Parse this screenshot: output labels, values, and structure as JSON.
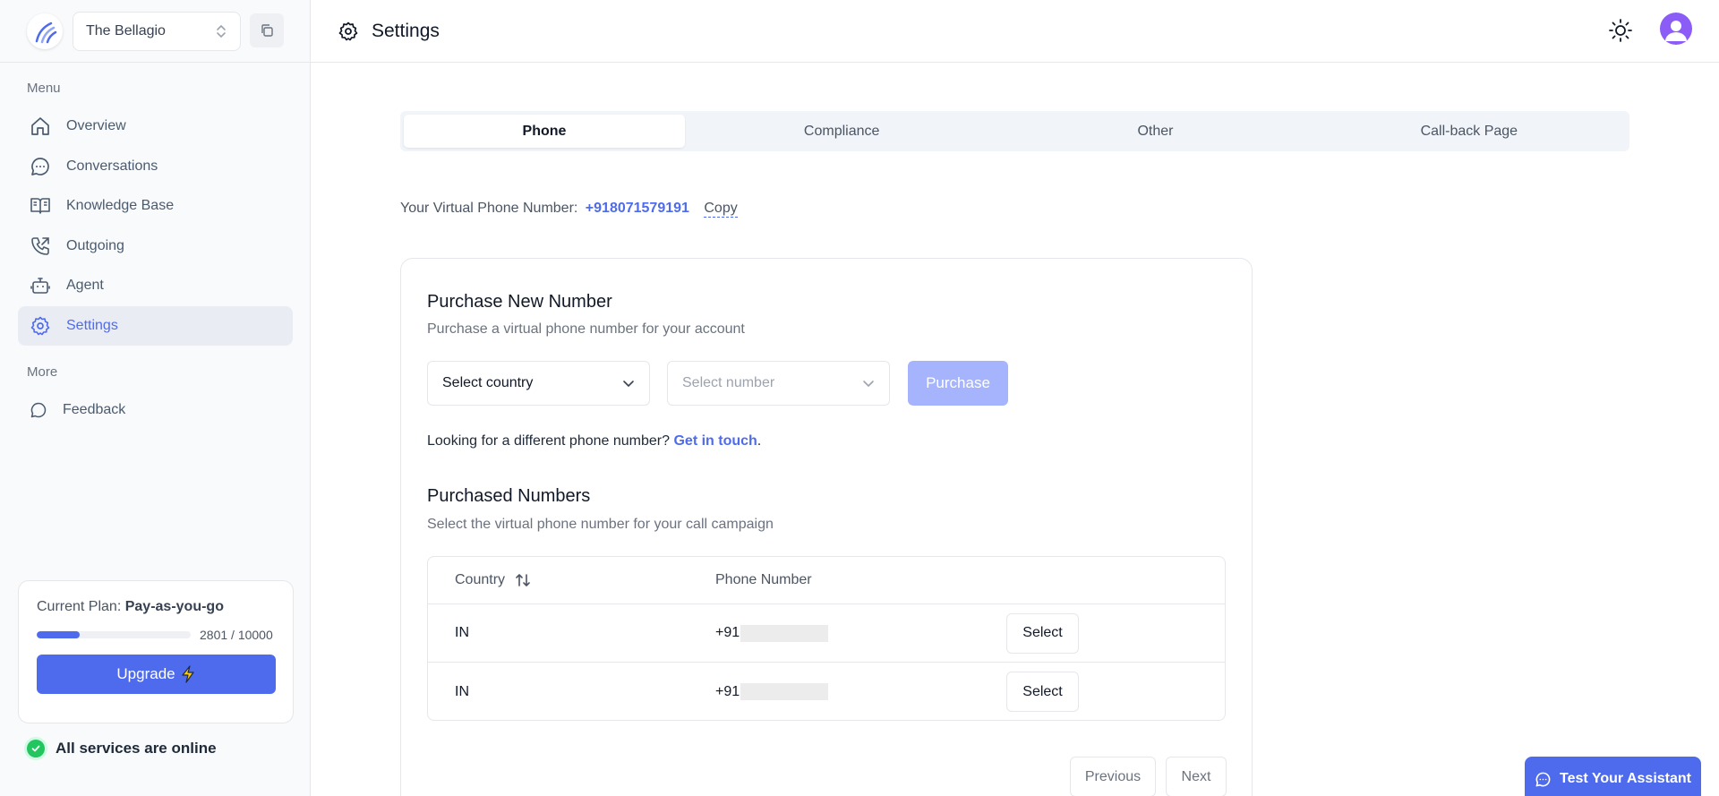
{
  "workspace": {
    "name": "The Bellagio"
  },
  "sidebar": {
    "menu_label": "Menu",
    "items": [
      {
        "label": "Overview",
        "icon": "home-icon"
      },
      {
        "label": "Conversations",
        "icon": "chat-bubble-icon"
      },
      {
        "label": "Knowledge Base",
        "icon": "book-icon"
      },
      {
        "label": "Outgoing",
        "icon": "phone-outgoing-icon"
      },
      {
        "label": "Agent",
        "icon": "bot-icon"
      },
      {
        "label": "Settings",
        "icon": "gear-icon",
        "active": true
      }
    ],
    "more_label": "More",
    "more_items": [
      {
        "label": "Feedback",
        "icon": "chat-bubble-icon"
      }
    ]
  },
  "plan": {
    "label": "Current Plan:",
    "name": "Pay-as-you-go",
    "usage_text": "2801 / 10000",
    "usage_fraction": 0.2801,
    "upgrade_label": "Upgrade"
  },
  "status": {
    "text": "All services are online",
    "color": "#22c55e"
  },
  "header": {
    "title": "Settings"
  },
  "tabs": [
    {
      "label": "Phone",
      "active": true
    },
    {
      "label": "Compliance"
    },
    {
      "label": "Other"
    },
    {
      "label": "Call-back Page"
    }
  ],
  "virtual_number": {
    "label": "Your Virtual Phone Number:",
    "number": "+918071579191",
    "copy_label": "Copy"
  },
  "purchase": {
    "title": "Purchase New Number",
    "subtitle": "Purchase a virtual phone number for your account",
    "country_placeholder": "Select country",
    "number_placeholder": "Select number",
    "button_label": "Purchase",
    "help_text": "Looking for a different phone number?",
    "help_link": "Get in touch",
    "help_end": "."
  },
  "purchased": {
    "title": "Purchased Numbers",
    "subtitle": "Select the virtual phone number for your call campaign",
    "columns": [
      "Country",
      "Phone Number"
    ],
    "rows": [
      {
        "country": "IN",
        "prefix": "+91",
        "action": "Select"
      },
      {
        "country": "IN",
        "prefix": "+91",
        "action": "Select"
      }
    ],
    "prev_label": "Previous",
    "next_label": "Next"
  },
  "assistant": {
    "label": "Test Your Assistant"
  },
  "colors": {
    "accent": "#4f6bed",
    "accent_light": "#a5b4fc",
    "avatar": "#8b5cf6"
  }
}
